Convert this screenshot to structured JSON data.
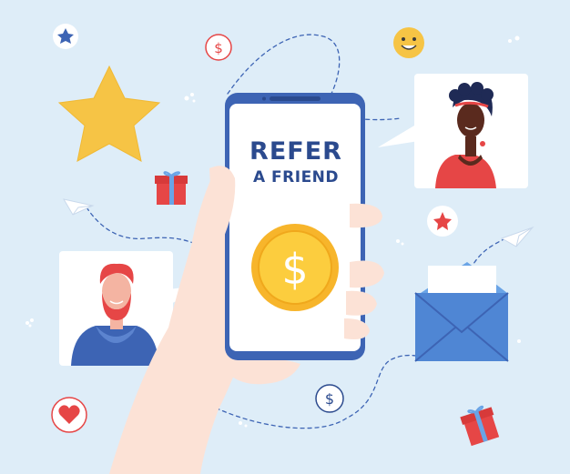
{
  "phone": {
    "headline_line1": "REFER",
    "headline_line2": "A FRIEND",
    "coin_symbol": "$"
  },
  "badges": {
    "dollar_symbol": "$"
  },
  "icons": [
    "star-icon",
    "smiley-icon",
    "dollar-icon",
    "gift-icon",
    "heart-icon",
    "paper-plane-icon",
    "envelope-icon"
  ],
  "colors": {
    "background": "#deedf8",
    "accent_blue": "#3d64b4",
    "headline": "#2b4a8e",
    "coin": "#f7b52b",
    "star": "#f6c445",
    "gift": "#e64646",
    "envelope": "#4f86d4"
  }
}
